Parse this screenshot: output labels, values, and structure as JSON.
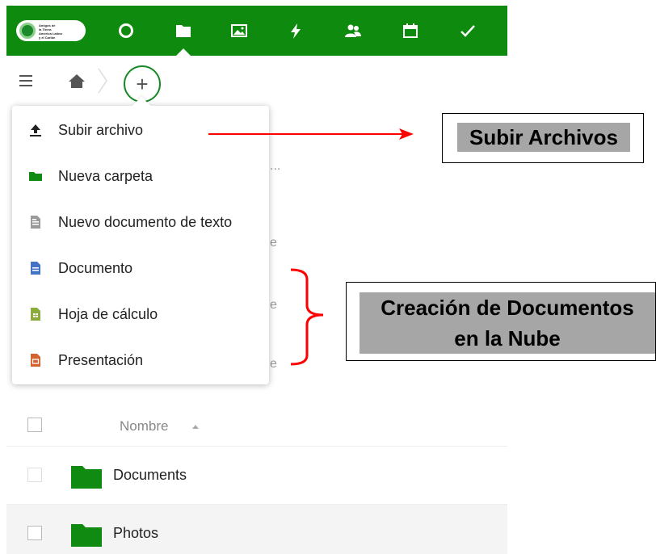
{
  "app": {
    "logo_text": "Amigos de\nla Tierra\nAmérica Latina\ny el Caribe",
    "nav_icons": [
      "dashboard-icon",
      "files-icon",
      "gallery-icon",
      "activity-icon",
      "contacts-icon",
      "calendar-icon",
      "tasks-icon"
    ],
    "active_nav": "files-icon",
    "accent_color": "#0e8a0e",
    "add_button": "+"
  },
  "menu": {
    "items": [
      {
        "label": "Subir archivo",
        "icon": "upload-icon"
      },
      {
        "label": "Nueva carpeta",
        "icon": "folder-icon"
      },
      {
        "label": "Nuevo documento de texto",
        "icon": "text-file-icon"
      },
      {
        "label": "Documento",
        "icon": "document-icon"
      },
      {
        "label": "Hoja de cálculo",
        "icon": "spreadsheet-icon"
      },
      {
        "label": "Presentación",
        "icon": "presentation-icon"
      }
    ]
  },
  "background": {
    "ellipsis": "...",
    "fragments": [
      "e",
      "e",
      "e"
    ]
  },
  "list": {
    "header": "Nombre",
    "rows": [
      {
        "name": "Documents"
      },
      {
        "name": "Photos"
      }
    ]
  },
  "annotations": {
    "upload_callout": "Subir Archivos",
    "create_callout_line1": "Creación de Documentos",
    "create_callout_line2": "en la Nube",
    "arrow_color": "#ff0000"
  }
}
